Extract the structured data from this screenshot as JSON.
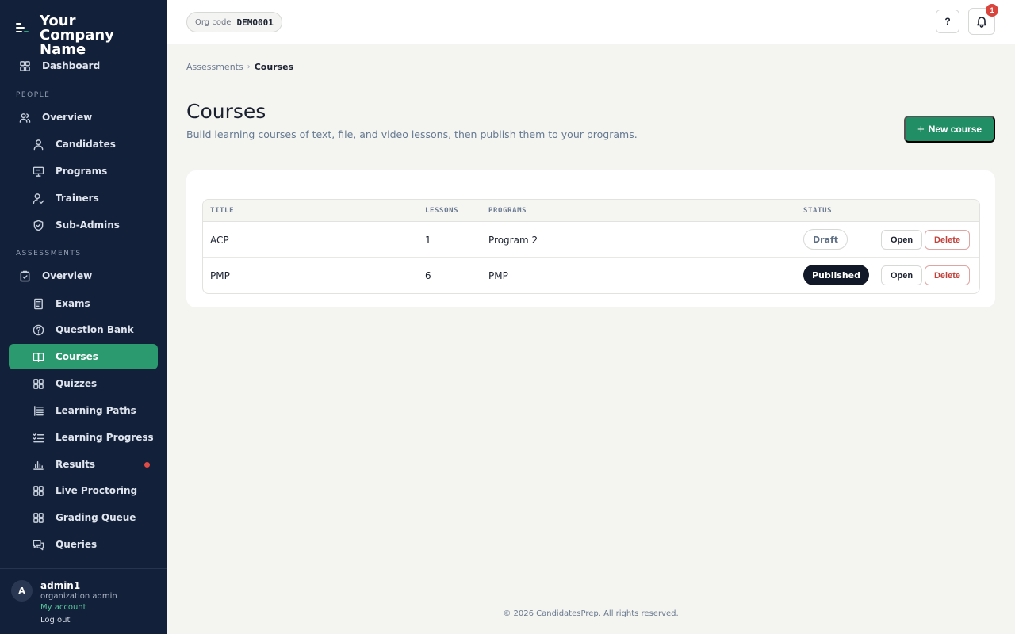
{
  "brand": {
    "name": "Your Company Name"
  },
  "sidebar": {
    "dashboard": {
      "label": "Dashboard",
      "icon": "grid-icon"
    },
    "people_section": "PEOPLE",
    "people": [
      {
        "label": "Overview",
        "icon": "users-icon"
      },
      {
        "label": "Candidates",
        "icon": "user-icon"
      },
      {
        "label": "Programs",
        "icon": "monitor-icon"
      },
      {
        "label": "Trainers",
        "icon": "user-check-icon"
      },
      {
        "label": "Sub-Admins",
        "icon": "shield-icon"
      }
    ],
    "assessments_section": "ASSESSMENTS",
    "assessments": [
      {
        "label": "Overview",
        "icon": "clipboard-check-icon"
      },
      {
        "label": "Exams",
        "icon": "document-icon"
      },
      {
        "label": "Question Bank",
        "icon": "help-circle-icon"
      },
      {
        "label": "Courses",
        "icon": "book-open-icon"
      },
      {
        "label": "Quizzes",
        "icon": "grid-icon"
      },
      {
        "label": "Learning Paths",
        "icon": "list-icon"
      },
      {
        "label": "Learning Progress",
        "icon": "list-check-icon"
      },
      {
        "label": "Results",
        "icon": "bar-chart-icon"
      },
      {
        "label": "Live Proctoring",
        "icon": "grid-icon"
      },
      {
        "label": "Grading Queue",
        "icon": "grid-icon"
      },
      {
        "label": "Queries",
        "icon": "chat-icon"
      }
    ],
    "user": {
      "initial": "A",
      "name": "admin1",
      "role": "organization admin",
      "account_link": "My account",
      "logout_link": "Log out"
    }
  },
  "topbar": {
    "org_label": "Org code",
    "org_code": "DEMO001",
    "help_label": "?",
    "notification_count": "1"
  },
  "breadcrumb": {
    "parent": "Assessments",
    "separator": "›",
    "current": "Courses"
  },
  "page": {
    "title": "Courses",
    "subtitle": "Build learning courses of text, file, and video lessons, then publish them to your programs.",
    "new_button": "New course",
    "new_button_icon": "+"
  },
  "table": {
    "headers": {
      "title": "TITLE",
      "lessons": "LESSONS",
      "programs": "PROGRAMS",
      "status": "STATUS"
    },
    "rows": [
      {
        "title": "ACP",
        "lessons": "1",
        "programs": "Program 2",
        "status": "Draft",
        "open": "Open",
        "delete": "Delete"
      },
      {
        "title": "PMP",
        "lessons": "6",
        "programs": "PMP",
        "status": "Published",
        "open": "Open",
        "delete": "Delete"
      }
    ]
  },
  "footer": {
    "text": "© 2026 CandidatesPrep. All rights reserved."
  },
  "colors": {
    "accent": "#228e66",
    "sidebar": "#13203a",
    "danger": "#c2413b",
    "alert_dot": "#e04b45"
  }
}
